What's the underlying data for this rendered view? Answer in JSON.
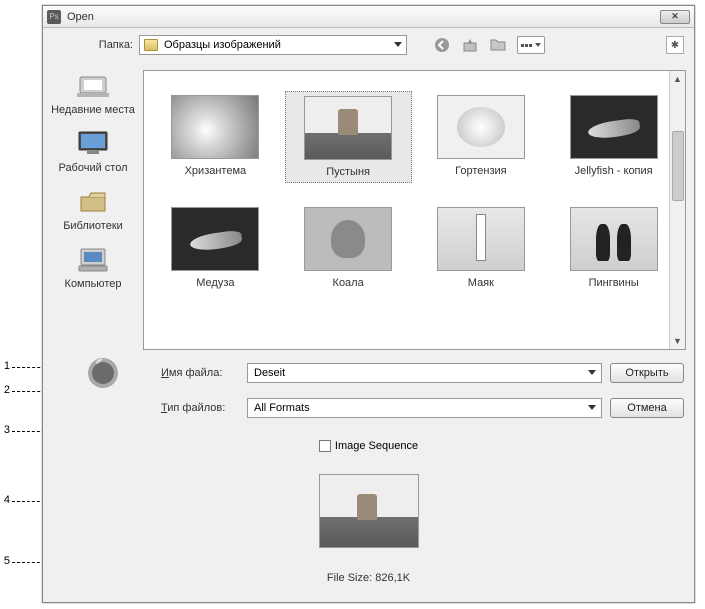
{
  "window": {
    "title": "Open"
  },
  "toolbar": {
    "folder_label": "Папка:",
    "folder_value": "Образцы изображений"
  },
  "sidebar": {
    "items": [
      {
        "label": "Недавние места"
      },
      {
        "label": "Рабочий стол"
      },
      {
        "label": "Библиотеки"
      },
      {
        "label": "Компьютер"
      }
    ]
  },
  "files": {
    "items": [
      {
        "label": "Хризантема",
        "art": "t-chrys"
      },
      {
        "label": "Пустыня",
        "art": "t-desert",
        "selected": true
      },
      {
        "label": "Гортензия",
        "art": "t-hort"
      },
      {
        "label": "Jellyfish - копия",
        "art": "t-jelly"
      },
      {
        "label": "Медуза",
        "art": "t-jelly"
      },
      {
        "label": "Коала",
        "art": "t-koala"
      },
      {
        "label": "Маяк",
        "art": "t-light"
      },
      {
        "label": "Пингвины",
        "art": "t-peng"
      }
    ]
  },
  "controls": {
    "filename_label": "Имя файла:",
    "filename_value": "Deseit",
    "filetype_label": "Тип файлов:",
    "filetype_value": "All Formats",
    "open_label": "Открыть",
    "cancel_label": "Отмена",
    "image_sequence_label": "Image Sequence",
    "filesize_label": "File Size: 826,1K"
  },
  "annotations": {
    "1": "1",
    "2": "2",
    "3": "3",
    "4": "4",
    "5": "5"
  }
}
